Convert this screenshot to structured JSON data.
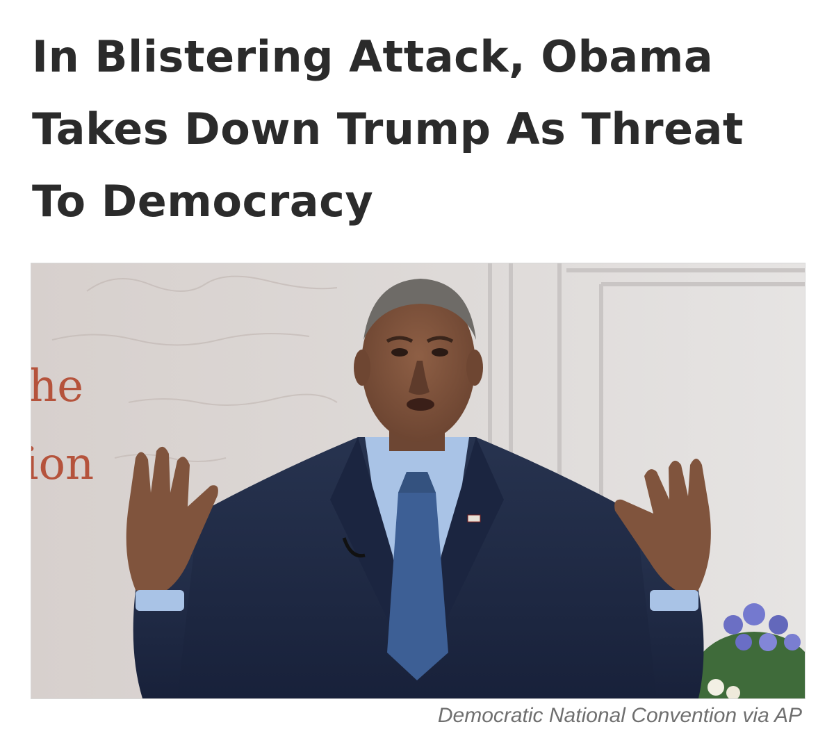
{
  "article": {
    "headline": "In Blistering Attack, Obama\nTakes Down Trump As Threat\nTo Democracy",
    "photo": {
      "backdrop_text_fragments": [
        "he",
        "ion"
      ],
      "credit": "Democratic National Convention via AP"
    }
  },
  "colors": {
    "headline": "#2b2b2b",
    "credit": "#6f6f6f",
    "backdrop_text": "#b5533c",
    "suit": "#1f2b45",
    "tie": "#3d5f95"
  }
}
